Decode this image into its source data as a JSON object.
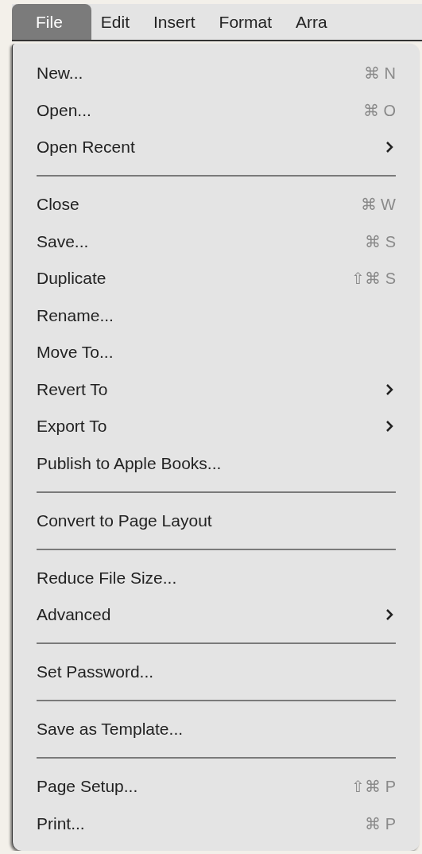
{
  "menubar": [
    {
      "label": "File",
      "selected": true
    },
    {
      "label": "Edit",
      "selected": false
    },
    {
      "label": "Insert",
      "selected": false
    },
    {
      "label": "Format",
      "selected": false
    },
    {
      "label": "Arra",
      "selected": false
    }
  ],
  "menu": {
    "sections": [
      [
        {
          "label": "New...",
          "shortcut": "⌘ N",
          "submenu": false
        },
        {
          "label": "Open...",
          "shortcut": "⌘ O",
          "submenu": false
        },
        {
          "label": "Open Recent",
          "submenu": true
        }
      ],
      [
        {
          "label": "Close",
          "shortcut": "⌘ W",
          "submenu": false
        },
        {
          "label": "Save...",
          "shortcut": "⌘ S",
          "submenu": false
        },
        {
          "label": "Duplicate",
          "shortcut": "⇧⌘ S",
          "submenu": false
        },
        {
          "label": "Rename...",
          "submenu": false
        },
        {
          "label": "Move To...",
          "submenu": false
        },
        {
          "label": "Revert To",
          "submenu": true
        },
        {
          "label": "Export To",
          "submenu": true
        },
        {
          "label": "Publish to Apple Books...",
          "submenu": false
        }
      ],
      [
        {
          "label": "Convert to Page Layout",
          "submenu": false
        }
      ],
      [
        {
          "label": "Reduce File Size...",
          "submenu": false
        },
        {
          "label": "Advanced",
          "submenu": true
        }
      ],
      [
        {
          "label": "Set Password...",
          "submenu": false
        }
      ],
      [
        {
          "label": "Save as Template...",
          "submenu": false
        }
      ],
      [
        {
          "label": "Page Setup...",
          "shortcut": "⇧⌘ P",
          "submenu": false
        },
        {
          "label": "Print...",
          "shortcut": "⌘ P",
          "submenu": false
        }
      ]
    ]
  }
}
